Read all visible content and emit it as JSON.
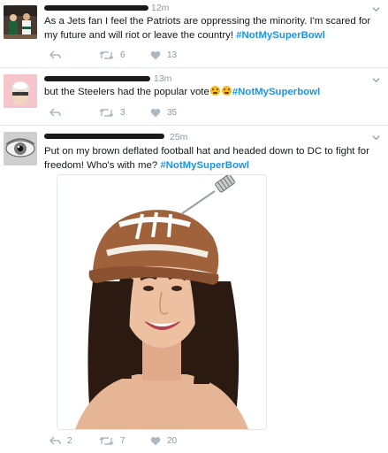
{
  "tweets": [
    {
      "time": "12m",
      "text": "As a Jets fan I feel the Patriots are oppressing the minority. I'm scared for my future and will riot or leave the country! ",
      "hashtag": "#NotMySuperBowl",
      "actions": {
        "reply": "",
        "retweet": "6",
        "like": "13"
      }
    },
    {
      "time": "13m",
      "text": "but the Steelers had the popular vote",
      "hashtag": "#NotMySuperbowl",
      "actions": {
        "reply": "",
        "retweet": "3",
        "like": "35"
      }
    },
    {
      "time": "25m",
      "text": "Put on my brown deflated football hat and headed down to DC to fight for freedom! Who's with me? ",
      "hashtag": "#NotMySuperBowl",
      "actions": {
        "reply": "2",
        "retweet": "7",
        "like": "20"
      }
    }
  ],
  "icons": {
    "reply": "reply-icon",
    "retweet": "retweet-icon",
    "like": "heart-icon",
    "more": "chevron-down-icon",
    "emoji": "angry-face-emoji"
  },
  "colors": {
    "hashtag": "#1b95e0",
    "muted": "#8899a6",
    "divider": "#e1e8ed"
  }
}
